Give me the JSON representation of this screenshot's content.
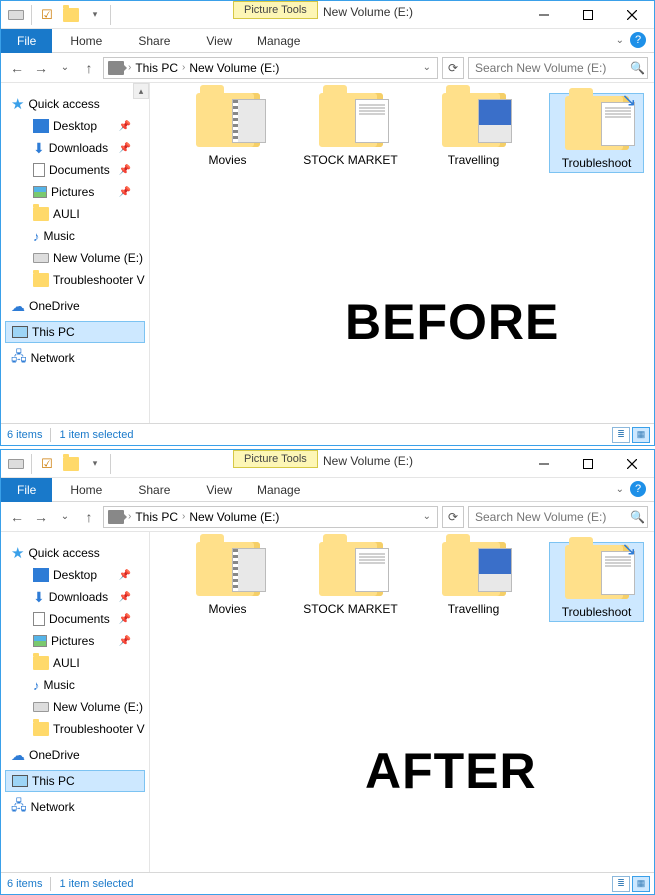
{
  "window": {
    "title": "New Volume (E:)",
    "tools_tab": "Picture Tools"
  },
  "ribbon": {
    "file": "File",
    "tabs": [
      "Home",
      "Share",
      "View"
    ],
    "manage": "Manage"
  },
  "address": {
    "parts": [
      "This PC",
      "New Volume (E:)"
    ]
  },
  "search": {
    "placeholder": "Search New Volume (E:)"
  },
  "sidebar": {
    "quick_access": "Quick access",
    "items": [
      {
        "label": "Desktop",
        "pinned": true
      },
      {
        "label": "Downloads",
        "pinned": true
      },
      {
        "label": "Documents",
        "pinned": true
      },
      {
        "label": "Pictures",
        "pinned": true
      },
      {
        "label": "AULI",
        "pinned": false
      },
      {
        "label": "Music",
        "pinned": false
      },
      {
        "label": "New Volume (E:)",
        "pinned": false
      },
      {
        "label": "Troubleshooter V",
        "pinned": false
      }
    ],
    "onedrive": "OneDrive",
    "this_pc": "This PC",
    "network": "Network"
  },
  "folders": [
    {
      "label": "Movies"
    },
    {
      "label": "STOCK MARKET"
    },
    {
      "label": "Travelling"
    },
    {
      "label": "Troubleshoot"
    }
  ],
  "status": {
    "count": "6 items",
    "selection": "1 item selected"
  },
  "overlays": {
    "before": "BEFORE",
    "after": "AFTER"
  }
}
